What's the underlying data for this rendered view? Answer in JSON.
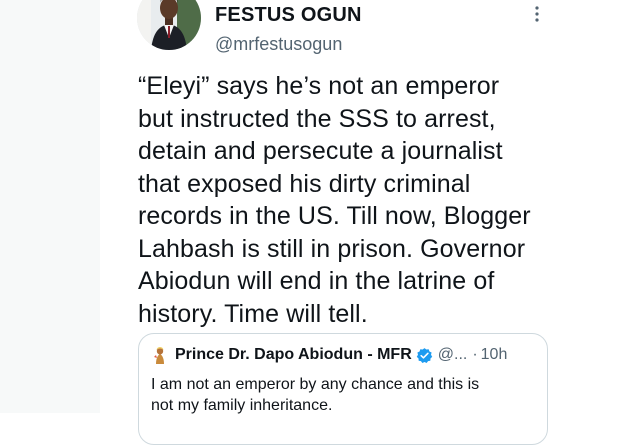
{
  "tweet": {
    "author_name": "FESTUS OGUN",
    "author_handle": "@mrfestusogun",
    "text": "“Eleyi” says he’s not an emperor\nbut instructed the SSS to arrest,\ndetain and persecute a journalist\nthat exposed his dirty criminal\nrecords in the US. Till now, Blogger\nLahbash is still in prison. Governor\nAbiodun will end in the latrine of\nhistory. Time will tell.",
    "more_icon": "more-vertical-icon"
  },
  "quoted_tweet": {
    "author_name": "Prince Dr. Dapo Abiodun - MFR",
    "verified_icon": "verified-badge-icon",
    "author_handle": "@...",
    "separator": "·",
    "time": "10h",
    "text": "I am not an emperor by any chance and this is\nnot my family inheritance."
  },
  "colors": {
    "text": "#0f1419",
    "secondary_text": "#536471",
    "verified": "#1d9bf0",
    "border": "#cfd9de"
  }
}
